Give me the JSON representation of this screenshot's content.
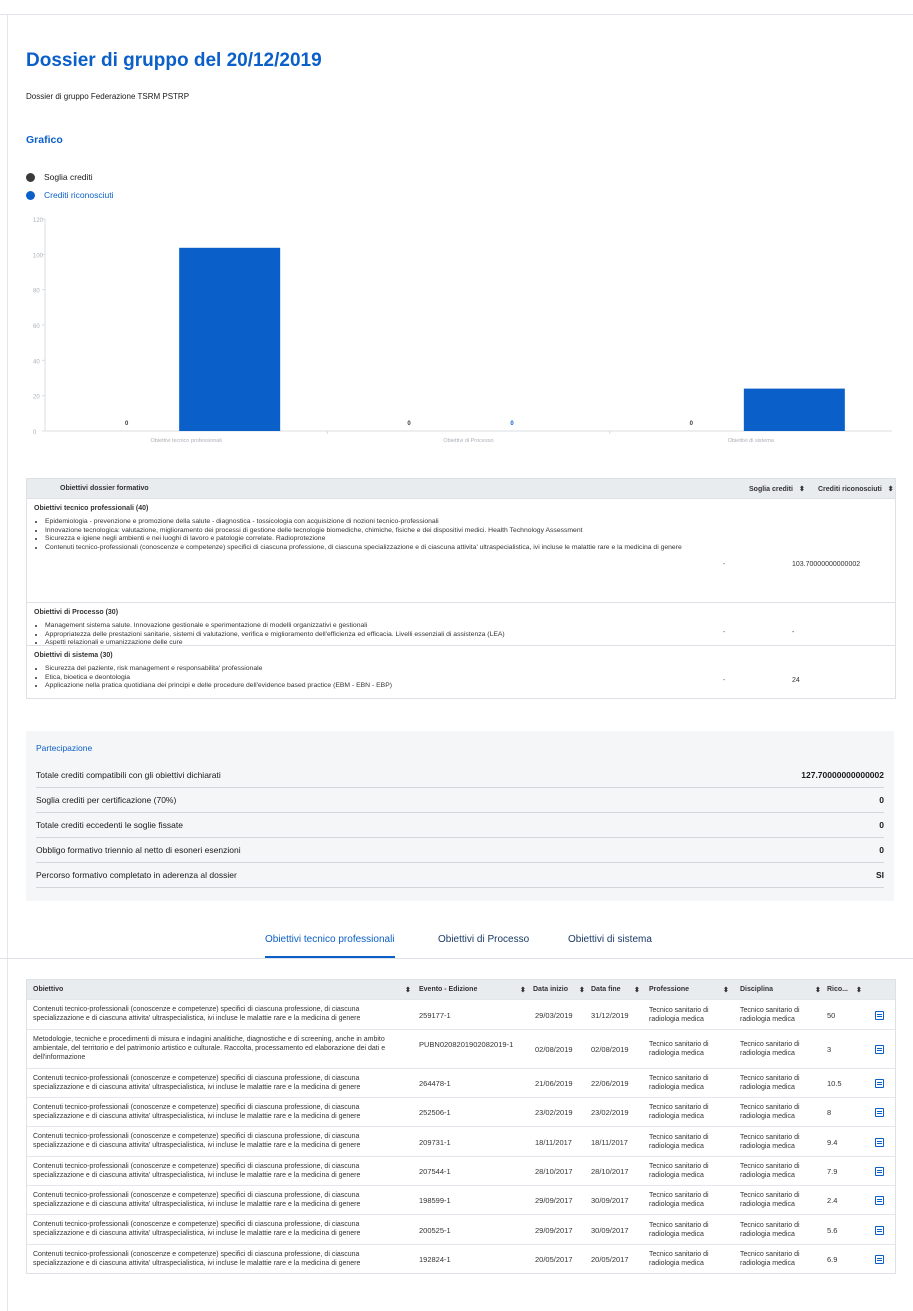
{
  "page": {
    "title": "Dossier di gruppo del 20/12/2019",
    "subtitle": "Dossier di gruppo Federazione TSRM PSTRP",
    "chart_section_title": "Grafico"
  },
  "colors": {
    "accent": "#0a5fc9",
    "soglia": "#3a3a3a",
    "crediti": "#0a5fc9"
  },
  "chart_data": {
    "type": "bar",
    "categories": [
      "Obiettivi tecnico professionali",
      "Obiettivi di Processo",
      "Obiettivi di sistema"
    ],
    "series": [
      {
        "name": "Soglia crediti",
        "values": [
          0,
          0,
          0
        ]
      },
      {
        "name": "Crediti riconosciuti",
        "values": [
          103.7,
          0,
          24
        ]
      }
    ],
    "ylim": [
      0,
      120
    ],
    "yticks": [
      0,
      20,
      40,
      60,
      80,
      100,
      120
    ],
    "legend": "top-left",
    "grid": false
  },
  "objectives_table": {
    "headers": {
      "objective": "Obiettivi dossier formativo",
      "soglia": "Soglia crediti",
      "crediti": "Crediti riconosciuti"
    },
    "groups": [
      {
        "title": "Obiettivi tecnico professionali (40)",
        "items": [
          "Epidemiologia - prevenzione e promozione della salute - diagnostica - tossicologia con acquisizione di nozioni tecnico-professionali",
          "Innovazione tecnologica: valutazione, miglioramento dei processi di gestione delle tecnologie biomediche, chimiche, fisiche e dei dispositivi medici. Health Technology Assessment",
          "Sicurezza e igiene negli ambienti e nei luoghi di lavoro e patologie correlate. Radioprotezione",
          "Contenuti tecnico-professionali (conoscenze e competenze) specifici di ciascuna professione, di ciascuna specializzazione e di ciascuna attivita' ultraspecialistica, ivi incluse le malattie rare e la medicina di genere"
        ],
        "soglia": "-",
        "crediti": "103.70000000000002"
      },
      {
        "title": "Obiettivi di Processo (30)",
        "items": [
          "Management sistema salute. Innovazione gestionale e sperimentazione di modelli organizzativi e gestionali",
          "Appropriatezza delle prestazioni sanitarie, sistemi di valutazione, verifica e miglioramento dell'efficienza ed efficacia. Livelli essenziali di assistenza (LEA)",
          "Aspetti relazionali e umanizzazione delle cure"
        ],
        "soglia": "-",
        "crediti": "-"
      },
      {
        "title": "Obiettivi di sistema (30)",
        "items": [
          "Sicurezza del paziente, risk management e responsabilita' professionale",
          "Etica, bioetica e deontologia",
          "Applicazione nella pratica quotidiana dei principi e delle procedure dell'evidence based practice (EBM - EBN - EBP)"
        ],
        "soglia": "-",
        "crediti": "24"
      }
    ]
  },
  "participation": {
    "title": "Partecipazione",
    "rows": [
      {
        "label": "Totale crediti compatibili con gli obiettivi dichiarati",
        "value": "127.70000000000002"
      },
      {
        "label": "Soglia crediti per certificazione (70%)",
        "value": "0"
      },
      {
        "label": "Totale crediti eccedenti le soglie fissate",
        "value": "0"
      },
      {
        "label": "Obbligo formativo triennio al netto di esoneri esenzioni",
        "value": "0"
      },
      {
        "label": "Percorso formativo completato in aderenza al dossier",
        "value": "SI"
      }
    ]
  },
  "tabs": [
    "Obiettivi tecnico professionali",
    "Obiettivi di Processo",
    "Obiettivi di sistema"
  ],
  "events_table": {
    "headers": [
      "Obiettivo",
      "Evento - Edizione",
      "Data inizio",
      "Data fine",
      "Professione",
      "Disciplina",
      "Rico..."
    ],
    "rows": [
      {
        "obiettivo": "Contenuti tecnico-professionali (conoscenze e competenze) specifici di ciascuna professione, di ciascuna specializzazione e di ciascuna attivita' ultraspecialistica, ivi incluse le malattie rare e la medicina di genere",
        "evento": "259177-1",
        "inizio": "29/03/2019",
        "fine": "31/12/2019",
        "professione": "Tecnico sanitario di radiologia medica",
        "disciplina": "Tecnico sanitario di radiologia medica",
        "crediti": "50"
      },
      {
        "obiettivo": "Metodologie, tecniche e procedimenti di misura e indagini analitiche, diagnostiche e di screening, anche in ambito ambientale, del territorio e del patrimonio artistico e culturale. Raccolta, processamento ed elaborazione dei dati e dell'informazione",
        "evento": "PUBN0208201902082019-1",
        "inizio": "02/08/2019",
        "fine": "02/08/2019",
        "professione": "Tecnico sanitario di radiologia medica",
        "disciplina": "Tecnico sanitario di radiologia medica",
        "crediti": "3"
      },
      {
        "obiettivo": "Contenuti tecnico-professionali (conoscenze e competenze) specifici di ciascuna professione, di ciascuna specializzazione e di ciascuna attivita' ultraspecialistica, ivi incluse le malattie rare e la medicina di genere",
        "evento": "264478-1",
        "inizio": "21/06/2019",
        "fine": "22/06/2019",
        "professione": "Tecnico sanitario di radiologia medica",
        "disciplina": "Tecnico sanitario di radiologia medica",
        "crediti": "10.5"
      },
      {
        "obiettivo": "Contenuti tecnico-professionali (conoscenze e competenze) specifici di ciascuna professione, di ciascuna specializzazione e di ciascuna attivita' ultraspecialistica, ivi incluse le malattie rare e la medicina di genere",
        "evento": "252506-1",
        "inizio": "23/02/2019",
        "fine": "23/02/2019",
        "professione": "Tecnico sanitario di radiologia medica",
        "disciplina": "Tecnico sanitario di radiologia medica",
        "crediti": "8"
      },
      {
        "obiettivo": "Contenuti tecnico-professionali (conoscenze e competenze) specifici di ciascuna professione, di ciascuna specializzazione e di ciascuna attivita' ultraspecialistica, ivi incluse le malattie rare e la medicina di genere",
        "evento": "209731-1",
        "inizio": "18/11/2017",
        "fine": "18/11/2017",
        "professione": "Tecnico sanitario di radiologia medica",
        "disciplina": "Tecnico sanitario di radiologia medica",
        "crediti": "9.4"
      },
      {
        "obiettivo": "Contenuti tecnico-professionali (conoscenze e competenze) specifici di ciascuna professione, di ciascuna specializzazione e di ciascuna attivita' ultraspecialistica, ivi incluse le malattie rare e la medicina di genere",
        "evento": "207544-1",
        "inizio": "28/10/2017",
        "fine": "28/10/2017",
        "professione": "Tecnico sanitario di radiologia medica",
        "disciplina": "Tecnico sanitario di radiologia medica",
        "crediti": "7.9"
      },
      {
        "obiettivo": "Contenuti tecnico-professionali (conoscenze e competenze) specifici di ciascuna professione, di ciascuna specializzazione e di ciascuna attivita' ultraspecialistica, ivi incluse le malattie rare e la medicina di genere",
        "evento": "198599-1",
        "inizio": "29/09/2017",
        "fine": "30/09/2017",
        "professione": "Tecnico sanitario di radiologia medica",
        "disciplina": "Tecnico sanitario di radiologia medica",
        "crediti": "2.4"
      },
      {
        "obiettivo": "Contenuti tecnico-professionali (conoscenze e competenze) specifici di ciascuna professione, di ciascuna specializzazione e di ciascuna attivita' ultraspecialistica, ivi incluse le malattie rare e la medicina di genere",
        "evento": "200525-1",
        "inizio": "29/09/2017",
        "fine": "30/09/2017",
        "professione": "Tecnico sanitario di radiologia medica",
        "disciplina": "Tecnico sanitario di radiologia medica",
        "crediti": "5.6"
      },
      {
        "obiettivo": "Contenuti tecnico-professionali (conoscenze e competenze) specifici di ciascuna professione, di ciascuna specializzazione e di ciascuna attivita' ultraspecialistica, ivi incluse le malattie rare e la medicina di genere",
        "evento": "192824-1",
        "inizio": "20/05/2017",
        "fine": "20/05/2017",
        "professione": "Tecnico sanitario di radiologia medica",
        "disciplina": "Tecnico sanitario di radiologia medica",
        "crediti": "6.9"
      }
    ]
  }
}
